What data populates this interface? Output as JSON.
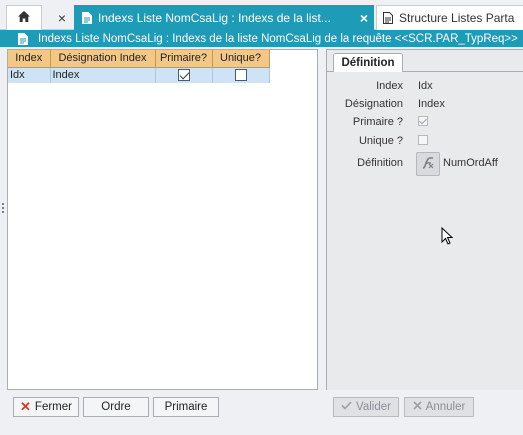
{
  "tabs": {
    "home_icon": "home-icon",
    "close_glyph": "×",
    "active": {
      "label": "Indexs Liste NomCsaLig : Indexs de la list...",
      "close_glyph": "×"
    },
    "inactive": {
      "label": "Structure Listes Parta"
    }
  },
  "title_strip": {
    "text": "Indexs Liste NomCsaLig : Indexs de la liste NomCsaLig de la requête <<SCR.PAR_TypReq>>"
  },
  "grid": {
    "headers": [
      "Index",
      "Désignation Index",
      "Primaire?",
      "Unique?"
    ],
    "rows": [
      {
        "index": "Idx",
        "designation": "Index",
        "primaire": true,
        "unique": false
      }
    ]
  },
  "left_buttons": {
    "fermer": "Fermer",
    "ordre": "Ordre",
    "primaire": "Primaire"
  },
  "detail": {
    "tab_label": "Définition",
    "index_label": "Index",
    "index_value": "Idx",
    "designation_label": "Désignation",
    "designation_value": "Index",
    "primaire_label": "Primaire ?",
    "primaire_checked": true,
    "unique_label": "Unique ?",
    "unique_checked": false,
    "definition_label": "Définition",
    "definition_value": "NumOrdAff"
  },
  "right_buttons": {
    "valider": "Valider",
    "annuler": "Annuler"
  },
  "colors": {
    "accent": "#1e9bb7",
    "header_bg": "#f3c887",
    "selected_row": "#cfe3f6"
  }
}
